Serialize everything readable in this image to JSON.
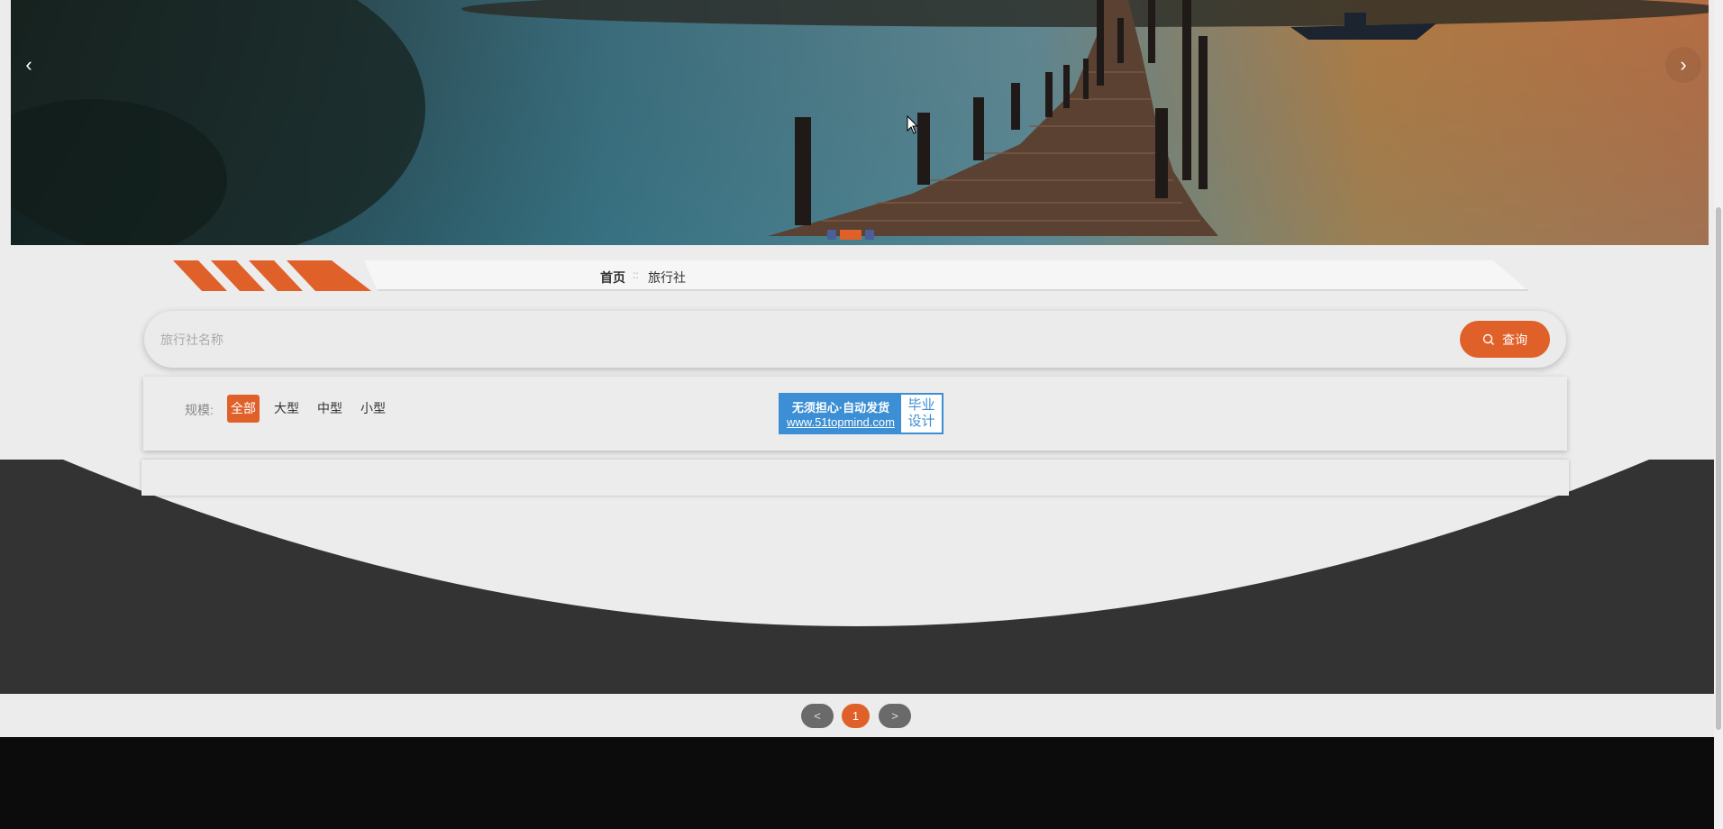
{
  "banner": {
    "prev_arrow": "‹",
    "next_arrow": "›",
    "slide_count": 3,
    "active_slide": 2
  },
  "breadcrumb": {
    "home": "首页",
    "separator": "::",
    "current": "旅行社"
  },
  "search": {
    "placeholder": "旅行社名称",
    "button_label": "查询"
  },
  "filter": {
    "label": "规模:",
    "options": [
      "全部",
      "大型",
      "中型",
      "小型"
    ],
    "selected": "全部"
  },
  "ad": {
    "line1": "无须担心·自动发货",
    "url": "www.51topmind.com",
    "side1": "毕业",
    "side2": "设计"
  },
  "pagination": {
    "prev": "<",
    "current": "1",
    "next": ">"
  },
  "colors": {
    "accent": "#e0602a",
    "dark_band": "#333333",
    "footer": "#0c0c0c",
    "ad_blue": "#3c8fd4"
  }
}
